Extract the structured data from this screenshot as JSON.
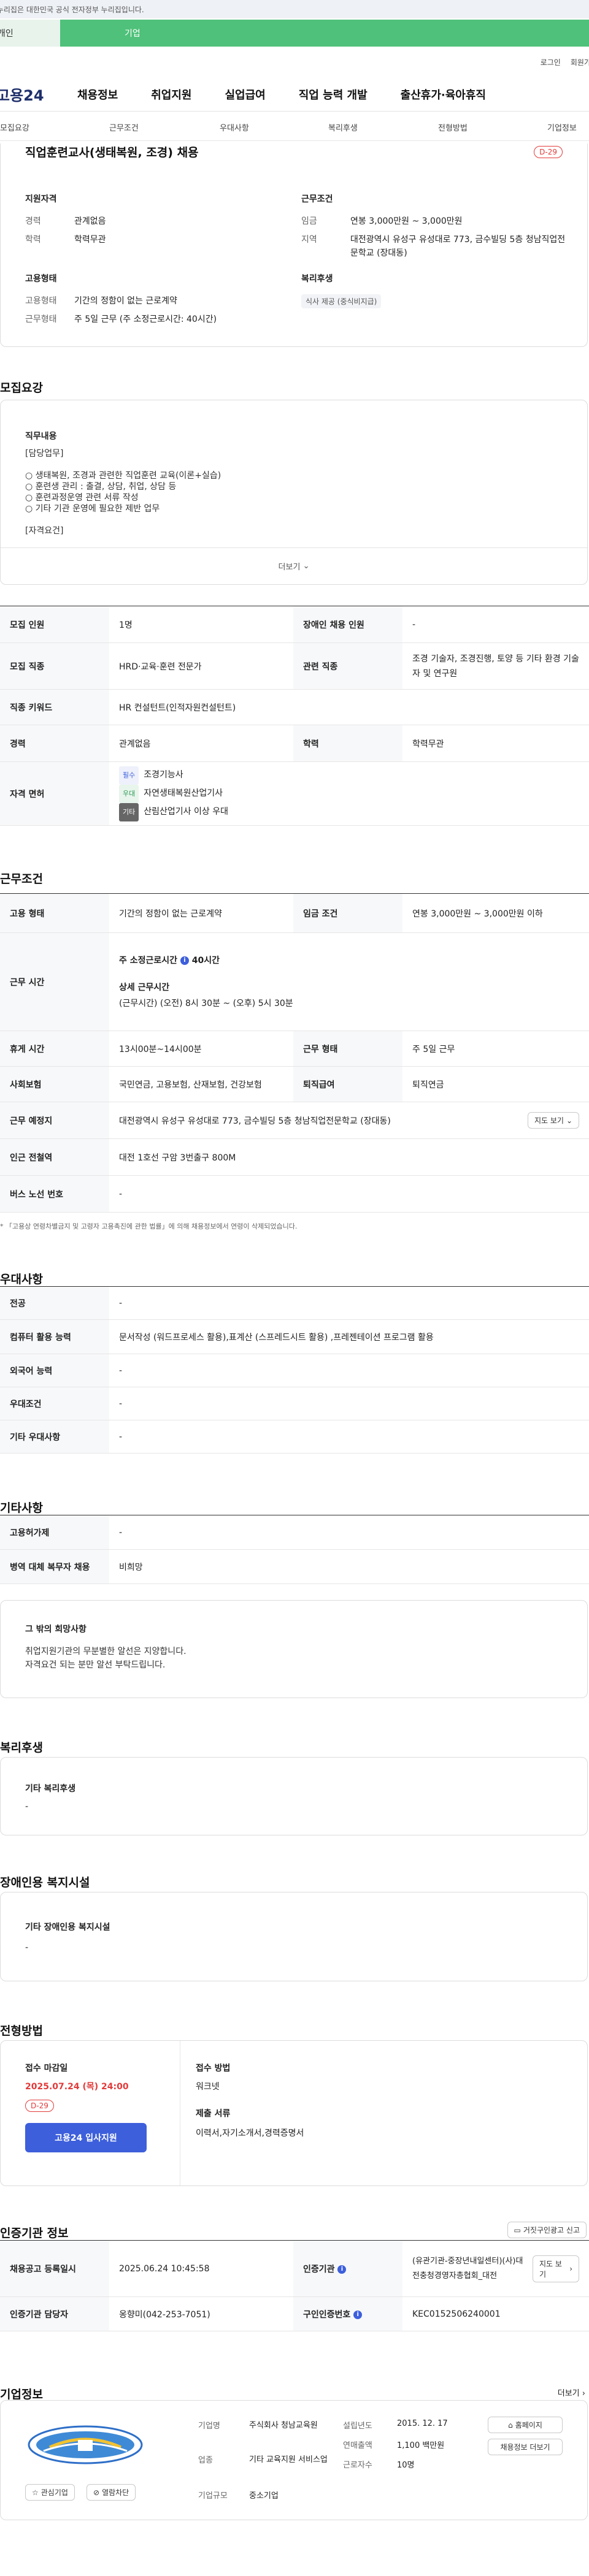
{
  "gov_banner": "이 누리집은 대한민국 공식 전자정부 누리집입니다.",
  "tabs": {
    "personal": "개인",
    "corporate": "기업"
  },
  "util": {
    "login": "로그인",
    "join": "회원가입"
  },
  "logo": "고용24",
  "gnb": [
    "채용정보",
    "취업지원",
    "실업급여",
    "직업 능력 개발",
    "출산휴가·육아휴직"
  ],
  "subnav": [
    "모집요강",
    "근무조건",
    "우대사항",
    "복리후생",
    "전형방법",
    "기업정보"
  ],
  "summary": {
    "title": "직업훈련교사(생태복원, 조경) 채용",
    "dday": "D-29",
    "qual_title": "지원자격",
    "career_k": "경력",
    "career_v": "관계없음",
    "edu_k": "학력",
    "edu_v": "학력무관",
    "cond_title": "근무조건",
    "wage_k": "임금",
    "wage_v": "연봉 3,000만원 ~ 3,000만원",
    "area_k": "지역",
    "area_v": "대전광역시 유성구 유성대로 773, 금수빌딩 5층 청남직업전문학교 (장대동)",
    "emp_title": "고용형태",
    "emptype_k": "고용형태",
    "emptype_v": "기간의 정함이 없는 근로계약",
    "worktype_k": "근무형태",
    "worktype_v": "주 5일 근무 (주 소정근로시간: 40시간)",
    "welfare_title": "복리후생",
    "welfare_tag": "식사 제공 (중식비지급)"
  },
  "recruit": {
    "section": "모집요강",
    "job_content_title": "직무내용",
    "lines": [
      "[담당업무]",
      "",
      "○ 생태복원, 조경과 관련한 직업훈련 교육(이론+실습)",
      "○ 훈련생 관리 : 출결, 상담, 취업, 상담 등",
      "○ 훈련과정운영 관련 서류 작성",
      "○ 기타 기관 운영에 필요한 제반 업무",
      "",
      "[자격요건]"
    ],
    "more": "더보기",
    "rows": {
      "count_k": "모집 인원",
      "count_v": "1명",
      "disabled_k": "장애인 채용 인원",
      "disabled_v": "-",
      "job_k": "모집 직종",
      "job_v": "HRD·교육·훈련 전문가",
      "related_k": "관련 직종",
      "related_v": "조경 기술자, 조경진행, 토양 등 기타 환경 기술자 및 연구원",
      "keyword_k": "직종 키워드",
      "keyword_v": "HR 컨설턴트(인적자원컨설턴트)",
      "career_k": "경력",
      "career_v": "관계없음",
      "edu_k": "학력",
      "edu_v": "학력무관",
      "license_k": "자격 면허",
      "licenses": [
        {
          "tag": "필수",
          "name": "조경기능사"
        },
        {
          "tag": "우대",
          "name": "자연생태복원산업기사"
        },
        {
          "tag": "기타",
          "name": "산림산업기사 이상 우대"
        }
      ]
    }
  },
  "work": {
    "section": "근무조건",
    "emptype_k": "고용 형태",
    "emptype_v": "기간의 정함이 없는 근로계약",
    "wage_k": "임금 조건",
    "wage_v": "연봉 3,000만원 ~ 3,000만원 이하",
    "hours_k": "근무 시간",
    "hours_main_label": "주 소정근로시간",
    "hours_main_value": "40시간",
    "hours_detail_label": "상세 근무시간",
    "hours_detail_value": "(근무시간) (오전) 8시 30분 ~ (오후) 5시 30분",
    "break_k": "휴게 시간",
    "break_v": "13시00분~14시00분",
    "worktype_k": "근무 형태",
    "worktype_v": "주 5일 근무",
    "insurance_k": "사회보험",
    "insurance_v": "국민연금, 고용보험, 산재보험, 건강보험",
    "severance_k": "퇴직급여",
    "severance_v": "퇴직연금",
    "place_k": "근무 예정지",
    "place_v": "대전광역시 유성구 유성대로 773, 금수빌딩 5층 청남직업전문학교 (장대동)",
    "map_btn": "지도 보기",
    "subway_k": "인근 전철역",
    "subway_v": "대전 1호선 구암 3번출구 800M",
    "bus_k": "버스 노선 번호",
    "bus_v": "-",
    "note": "「고용상 연령차별금지 및 고령자 고용촉진에 관한 법률」에 의해 채용정보에서 연령이 삭제되었습니다."
  },
  "pref": {
    "section": "우대사항",
    "major_k": "전공",
    "major_v": "-",
    "computer_k": "컴퓨터 활용 능력",
    "computer_v": "문서작성 (워드프로세스 활용),표계산 (스프레드시트 활용) ,프레젠테이션 프로그램 활용",
    "lang_k": "외국어 능력",
    "lang_v": "-",
    "cond_k": "우대조건",
    "cond_v": "-",
    "etc_k": "기타 우대사항",
    "etc_v": "-"
  },
  "etc": {
    "section": "기타사항",
    "loan_k": "고용허가제",
    "loan_v": "-",
    "military_k": "병역 대체 복무자 채용",
    "military_v": "비희망",
    "hope_title": "그 밖의 희망사항",
    "hope_lines": [
      "취업지원기관의 무분별한 알선은 지양합니다.",
      "자격요건 되는 분만 알선 부탁드립니다."
    ]
  },
  "welfare": {
    "section": "복리후생",
    "title": "기타 복리후생",
    "value": "-"
  },
  "disability": {
    "section": "장애인용 복지시설",
    "title": "기타 장애인용 복지시설",
    "value": "-"
  },
  "selection": {
    "section": "전형방법",
    "deadline_title": "접수 마감일",
    "deadline": "2025.07.24 (목) 24:00",
    "dday": "D-29",
    "apply_btn": "고용24 입사지원",
    "method_title": "접수 방법",
    "method": "워크넷",
    "docs_title": "제출 서류",
    "docs": "이력서,자기소개서,경력증명서"
  },
  "cert": {
    "section": "인증기관 정보",
    "report_btn": "거짓구인광고 신고",
    "reg_k": "채용공고 등록일시",
    "reg_v": "2025.06.24 10:45:58",
    "agency_k": "인증기관",
    "agency_v": "(유관기관-중장년내일센터)(사)대전충청경영자총협회_대전",
    "map_btn": "지도 보기",
    "manager_k": "인증기관 담당자",
    "manager_v": "옹향미(042-253-7051)",
    "num_k": "구인인증번호",
    "num_v": "KEC0152506240001"
  },
  "company": {
    "section": "기업정보",
    "more": "더보기",
    "interest_btn": "관심기업",
    "block_btn": "열람차단",
    "name_k": "기업명",
    "name_v": "주식회사 청남교육원",
    "industry_k": "업종",
    "industry_v": "기타 교육지원 서비스업",
    "size_k": "기업규모",
    "size_v": "중소기업",
    "founded_k": "설립년도",
    "founded_v": "2015. 12. 17",
    "sales_k": "연매출액",
    "sales_v": "1,100 백만원",
    "employees_k": "근로자수",
    "employees_v": "10명",
    "homepage_btn": "홈페이지",
    "jobs_btn": "채용정보 더보기"
  }
}
